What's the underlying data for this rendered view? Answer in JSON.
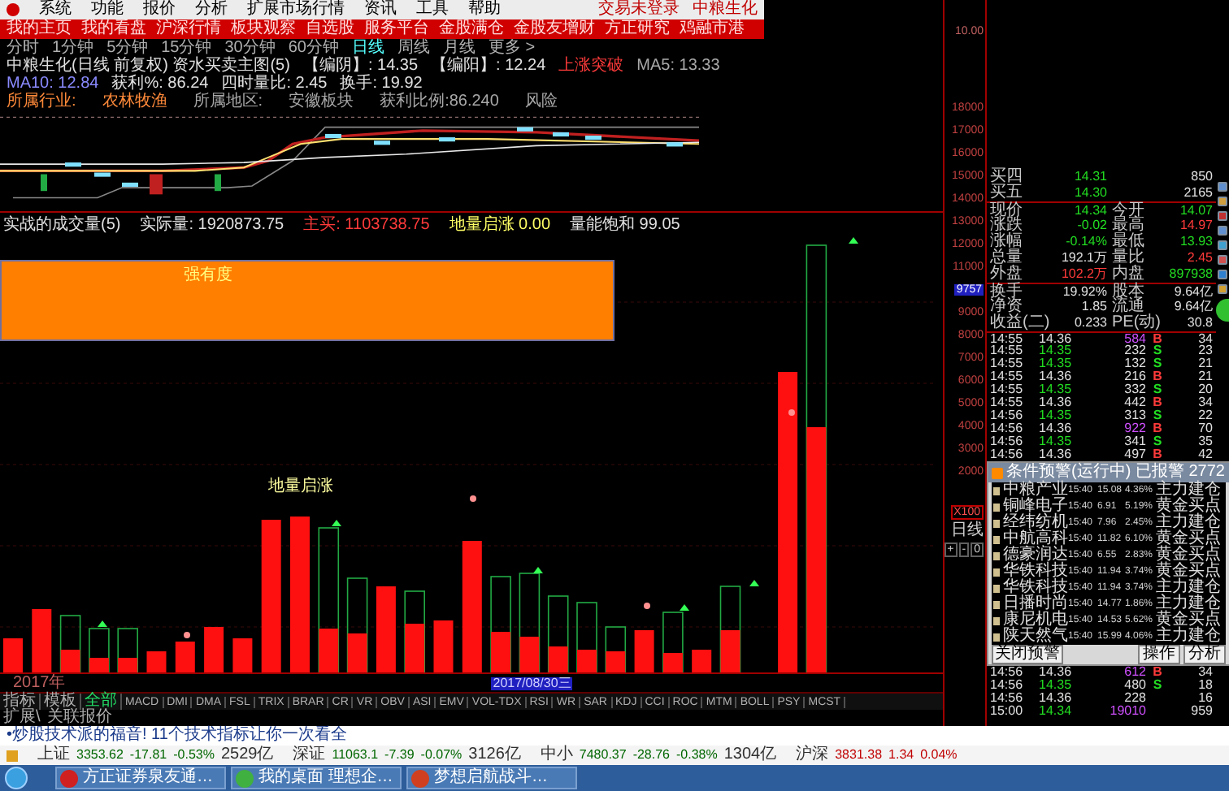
{
  "menu": {
    "items": [
      "系统",
      "功能",
      "报价",
      "分析",
      "扩展市场行情",
      "资讯",
      "工具",
      "帮助"
    ],
    "right": [
      "交易未登录",
      "中粮生化"
    ]
  },
  "nav": [
    "我的主页",
    "我的看盘",
    "沪深行情",
    "板块观察",
    "自选股",
    "服务平台",
    "金股满仓",
    "金股友增财",
    "方正研究",
    "鸡融市港"
  ],
  "periods": [
    {
      "label": "分时",
      "selected": false
    },
    {
      "label": "1分钟",
      "selected": false
    },
    {
      "label": "5分钟",
      "selected": false
    },
    {
      "label": "15分钟",
      "selected": false
    },
    {
      "label": "30分钟",
      "selected": false
    },
    {
      "label": "60分钟",
      "selected": false
    },
    {
      "label": "日线",
      "selected": true
    },
    {
      "label": "周线",
      "selected": false
    },
    {
      "label": "月线",
      "selected": false
    },
    {
      "label": "更多 >",
      "selected": false
    }
  ],
  "info_line": [
    {
      "text": "中粮生化(日线 前复权) 资水买卖主图(5)",
      "color": "#e0e0e0"
    },
    {
      "text": "【编阴】: 14.35",
      "color": "#e0e0e0"
    },
    {
      "text": "【编阳】: 12.24",
      "color": "#e0e0e0"
    },
    {
      "text": "上涨突破",
      "color": "#ff3a3a"
    },
    {
      "text": "MA5: 13.33",
      "color": "#a8a8a8"
    },
    {
      "text": "MA10: 12.84",
      "color": "#8a8aff"
    },
    {
      "text": "获利%: 86.24",
      "color": "#e0e0e0"
    },
    {
      "text": "四时量比: 2.45",
      "color": "#e0e0e0"
    },
    {
      "text": "换手: 19.92",
      "color": "#e0e0e0"
    }
  ],
  "info_line2": [
    {
      "text": "所属行业:",
      "color": "#ff8a3a"
    },
    {
      "text": "农林牧渔",
      "color": "#ff8a3a"
    },
    {
      "text": "所属地区:",
      "color": "#a8a8a8"
    },
    {
      "text": "安徽板块",
      "color": "#a8a8a8"
    },
    {
      "text": "获利比例:86.240",
      "color": "#a8a8a8"
    },
    {
      "text": "风险",
      "color": "#a8a8a8"
    }
  ],
  "volume_header": [
    {
      "text": "实战的成交量(5)",
      "color": "#e0e0e0"
    },
    {
      "text": "实际量: 1920873.75",
      "color": "#e0e0e0"
    },
    {
      "text": "主买: 1103738.75",
      "color": "#ff3a3a"
    },
    {
      "text": "地量启涨 0.00",
      "color": "#ffff66"
    },
    {
      "text": "量能饱和 99.05",
      "color": "#e0e0e0"
    }
  ],
  "overlay_box": {
    "text": "强有度"
  },
  "chart_label": "地量启涨",
  "date_labels": {
    "start": "2017年",
    "cursor": "2017/08/30三"
  },
  "indicator_tabs": [
    {
      "label": "指标",
      "selected": false
    },
    {
      "label": "模板",
      "selected": false
    },
    {
      "label": "全部",
      "selected": true
    },
    {
      "label": "MACD",
      "selected": false
    },
    {
      "label": "DMI",
      "selected": false
    },
    {
      "label": "DMA",
      "selected": false
    },
    {
      "label": "FSL",
      "selected": false
    },
    {
      "label": "TRIX",
      "selected": false
    },
    {
      "label": "BRAR",
      "selected": false
    },
    {
      "label": "CR",
      "selected": false
    },
    {
      "label": "VR",
      "selected": false
    },
    {
      "label": "OBV",
      "selected": false
    },
    {
      "label": "ASI",
      "selected": false
    },
    {
      "label": "EMV",
      "selected": false
    },
    {
      "label": "VOL-TDX",
      "selected": false
    },
    {
      "label": "RSI",
      "selected": false
    },
    {
      "label": "WR",
      "selected": false
    },
    {
      "label": "SAR",
      "selected": false
    },
    {
      "label": "KDJ",
      "selected": false
    },
    {
      "label": "CCI",
      "selected": false
    },
    {
      "label": "ROC",
      "selected": false
    },
    {
      "label": "MTM",
      "selected": false
    },
    {
      "label": "BOLL",
      "selected": false
    },
    {
      "label": "PSY",
      "selected": false
    },
    {
      "label": "MCST",
      "selected": false
    }
  ],
  "ext_tabs": [
    "扩展\\",
    "关联报价"
  ],
  "axis": {
    "price_label": "10.00",
    "labels": [
      {
        "text": "18000",
        "selected": false
      },
      {
        "text": "17000",
        "selected": false
      },
      {
        "text": "16000",
        "selected": false
      },
      {
        "text": "15000",
        "selected": false
      },
      {
        "text": "14000",
        "selected": false
      },
      {
        "text": "13000",
        "selected": false
      },
      {
        "text": "12000",
        "selected": false
      },
      {
        "text": "11000",
        "selected": false
      },
      {
        "text": "9757",
        "selected": true
      },
      {
        "text": "9000",
        "selected": false
      },
      {
        "text": "8000",
        "selected": false
      },
      {
        "text": "7000",
        "selected": false
      },
      {
        "text": "6000",
        "selected": false
      },
      {
        "text": "5000",
        "selected": false
      },
      {
        "text": "4000",
        "selected": false
      },
      {
        "text": "3000",
        "selected": false
      },
      {
        "text": "2000",
        "selected": false
      }
    ],
    "unit": "X100",
    "period": "日线",
    "controls": [
      "+",
      "-",
      "0"
    ]
  },
  "quote": [
    {
      "kind": "order",
      "label": "买四",
      "value": "14.31",
      "color": "#22dd22",
      "volume": "850"
    },
    {
      "kind": "order",
      "label": "买五",
      "value": "14.30",
      "color": "#22dd22",
      "volume": "2165"
    },
    {
      "kind": "pair",
      "label": "现价",
      "value": "14.34",
      "color": "#22dd22",
      "second": {
        "label": "今开",
        "value": "14.07",
        "color": "#22dd22"
      }
    },
    {
      "kind": "pair",
      "label": "涨跌",
      "value": "-0.02",
      "color": "#22dd22",
      "second": {
        "label": "最高",
        "value": "14.97",
        "color": "#ff3a3a"
      }
    },
    {
      "kind": "pair",
      "label": "涨幅",
      "value": "-0.14%",
      "color": "#22dd22",
      "second": {
        "label": "最低",
        "value": "13.93",
        "color": "#22dd22"
      }
    },
    {
      "kind": "pair",
      "label": "总量",
      "value": "192.1万",
      "color": "#e0e0e0",
      "second": {
        "label": "量比",
        "value": "2.45",
        "color": "#ff3a3a"
      }
    },
    {
      "kind": "pair",
      "label": "外盘",
      "value": "102.2万",
      "color": "#ff3a3a",
      "second": {
        "label": "内盘",
        "value": "897938",
        "color": "#22dd22"
      }
    },
    {
      "kind": "pair",
      "label": "换手",
      "value": "19.92%",
      "color": "#e0e0e0",
      "second": {
        "label": "股本",
        "value": "9.64亿",
        "color": "#e0e0e0"
      }
    },
    {
      "kind": "pair",
      "label": "净资",
      "value": "1.85",
      "color": "#e0e0e0",
      "second": {
        "label": "流通",
        "value": "9.64亿",
        "color": "#e0e0e0"
      }
    },
    {
      "kind": "pair",
      "label": "收益(二)",
      "value": "0.233",
      "color": "#e0e0e0",
      "second": {
        "label": "PE(动)",
        "value": "30.8",
        "color": "#e0e0e0"
      }
    }
  ],
  "ticks": [
    {
      "time": "14:55",
      "price": "14.36",
      "color": "#e0e0e0",
      "volume": "584",
      "big": true,
      "side": "B",
      "count": "34"
    },
    {
      "time": "14:55",
      "price": "14.35",
      "color": "#22dd22",
      "volume": "232",
      "big": false,
      "side": "S",
      "count": "23"
    },
    {
      "time": "14:55",
      "price": "14.35",
      "color": "#22dd22",
      "volume": "132",
      "big": false,
      "side": "S",
      "count": "21"
    },
    {
      "time": "14:55",
      "price": "14.36",
      "color": "#e0e0e0",
      "volume": "216",
      "big": false,
      "side": "B",
      "count": "21"
    },
    {
      "time": "14:55",
      "price": "14.35",
      "color": "#22dd22",
      "volume": "332",
      "big": false,
      "side": "S",
      "count": "20"
    },
    {
      "time": "14:55",
      "price": "14.36",
      "color": "#e0e0e0",
      "volume": "442",
      "big": false,
      "side": "B",
      "count": "34"
    },
    {
      "time": "14:56",
      "price": "14.35",
      "color": "#22dd22",
      "volume": "313",
      "big": false,
      "side": "S",
      "count": "22"
    },
    {
      "time": "14:56",
      "price": "14.36",
      "color": "#e0e0e0",
      "volume": "922",
      "big": true,
      "side": "B",
      "count": "70"
    },
    {
      "time": "14:56",
      "price": "14.35",
      "color": "#22dd22",
      "volume": "341",
      "big": false,
      "side": "S",
      "count": "35"
    },
    {
      "time": "14:56",
      "price": "14.36",
      "color": "#e0e0e0",
      "volume": "497",
      "big": false,
      "side": "B",
      "count": "42"
    }
  ],
  "ticks_after_alert": [
    {
      "time": "14:56",
      "price": "14.36",
      "color": "#e0e0e0",
      "volume": "612",
      "big": true,
      "side": "B",
      "count": "34"
    },
    {
      "time": "14:56",
      "price": "14.35",
      "color": "#22dd22",
      "volume": "480",
      "big": false,
      "side": "S",
      "count": "18"
    },
    {
      "time": "14:56",
      "price": "14.36",
      "color": "#e0e0e0",
      "volume": "228",
      "big": false,
      "count": "16"
    },
    {
      "time": "15:00",
      "price": "14.34",
      "color": "#22dd22",
      "volume": "19010",
      "big": true,
      "count": "959"
    }
  ],
  "alert": {
    "title": "条件预警(运行中) 已报警 2772",
    "rows": [
      {
        "name": "中粮产业",
        "time": "15:40",
        "price": "15.08",
        "pct": "4.36%",
        "signal": "主力建仓"
      },
      {
        "name": "铜峰电子",
        "time": "15:40",
        "price": "6.91",
        "pct": "5.19%",
        "signal": "黄金买点"
      },
      {
        "name": "经纬纺机",
        "time": "15:40",
        "price": "7.96",
        "pct": "2.45%",
        "signal": "主力建仓"
      },
      {
        "name": "中航高科",
        "time": "15:40",
        "price": "11.82",
        "pct": "6.10%",
        "signal": "黄金买点"
      },
      {
        "name": "德豪润达",
        "time": "15:40",
        "price": "6.55",
        "pct": "2.83%",
        "signal": "黄金买点"
      },
      {
        "name": "华铁科技",
        "time": "15:40",
        "price": "11.94",
        "pct": "3.74%",
        "signal": "黄金买点"
      },
      {
        "name": "华铁科技",
        "time": "15:40",
        "price": "11.94",
        "pct": "3.74%",
        "signal": "主力建仓"
      },
      {
        "name": "日播时尚",
        "time": "15:40",
        "price": "14.77",
        "pct": "1.86%",
        "signal": "主力建仓"
      },
      {
        "name": "康尼机电",
        "time": "15:40",
        "price": "14.53",
        "pct": "5.62%",
        "signal": "黄金买点"
      },
      {
        "name": "陕天然气",
        "time": "15:40",
        "price": "15.99",
        "pct": "4.06%",
        "signal": "主力建仓"
      }
    ],
    "close_button": "关闭预警",
    "buttons": [
      "操作",
      "分析"
    ]
  },
  "promo": "•炒股技术派的福音! 11个技术指标让你一次看全",
  "indices": [
    {
      "name": "上证",
      "value": "3353.62",
      "change": "-17.81",
      "pct": "-0.53%",
      "amount": "2529亿",
      "color": "#006600"
    },
    {
      "name": "深证",
      "value": "11063.1",
      "change": "-7.39",
      "pct": "-0.07%",
      "amount": "3126亿",
      "color": "#006600"
    },
    {
      "name": "中小",
      "value": "7480.37",
      "change": "-28.76",
      "pct": "-0.38%",
      "amount": "1304亿",
      "color": "#006600"
    },
    {
      "name": "沪深",
      "value": "3831.38",
      "change": "1.34",
      "pct": "0.04%",
      "color": "#c00000"
    }
  ],
  "taskbar": [
    "方正证券泉友通…",
    "我的桌面 理想企…",
    "梦想启航战斗…"
  ]
}
